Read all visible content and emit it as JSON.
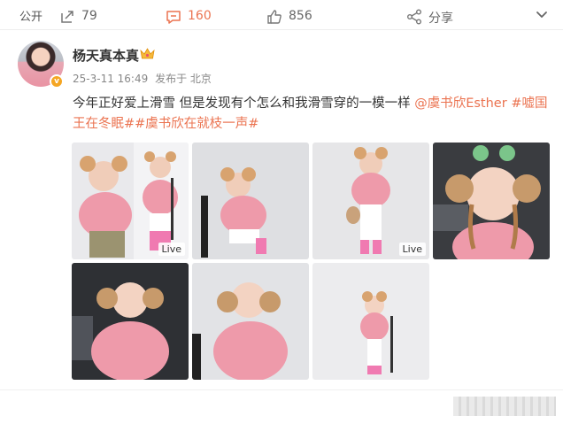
{
  "header": {
    "visibility_label": "公开",
    "menu_icon": "chevron-down-icon"
  },
  "author": {
    "name": "杨天真本真",
    "badge_icon": "crown-icon",
    "verified_mark": "v",
    "timestamp": "25-3-11 16:49",
    "source": "发布于 北京"
  },
  "post": {
    "text": "今年正好爱上滑雪 但是发现有个怎么和我滑雪穿的一模一样 ",
    "mention": "@虞书欣Esther",
    "hashtag1": "#嘘国王在冬眠#",
    "hashtag2": "#虞书欣在就枝一声#"
  },
  "photos": [
    {
      "live": "Live"
    },
    {
      "live": ""
    },
    {
      "live": "Live"
    },
    {
      "live": ""
    },
    {
      "live": ""
    },
    {
      "live": ""
    },
    {
      "live": ""
    }
  ],
  "actions": {
    "repost_count": "79",
    "comment_count": "160",
    "like_count": "856",
    "share_label": "分享"
  },
  "colors": {
    "accent": "#eb7350",
    "text": "#333333",
    "muted": "#888888",
    "badge": "#f5a623"
  }
}
